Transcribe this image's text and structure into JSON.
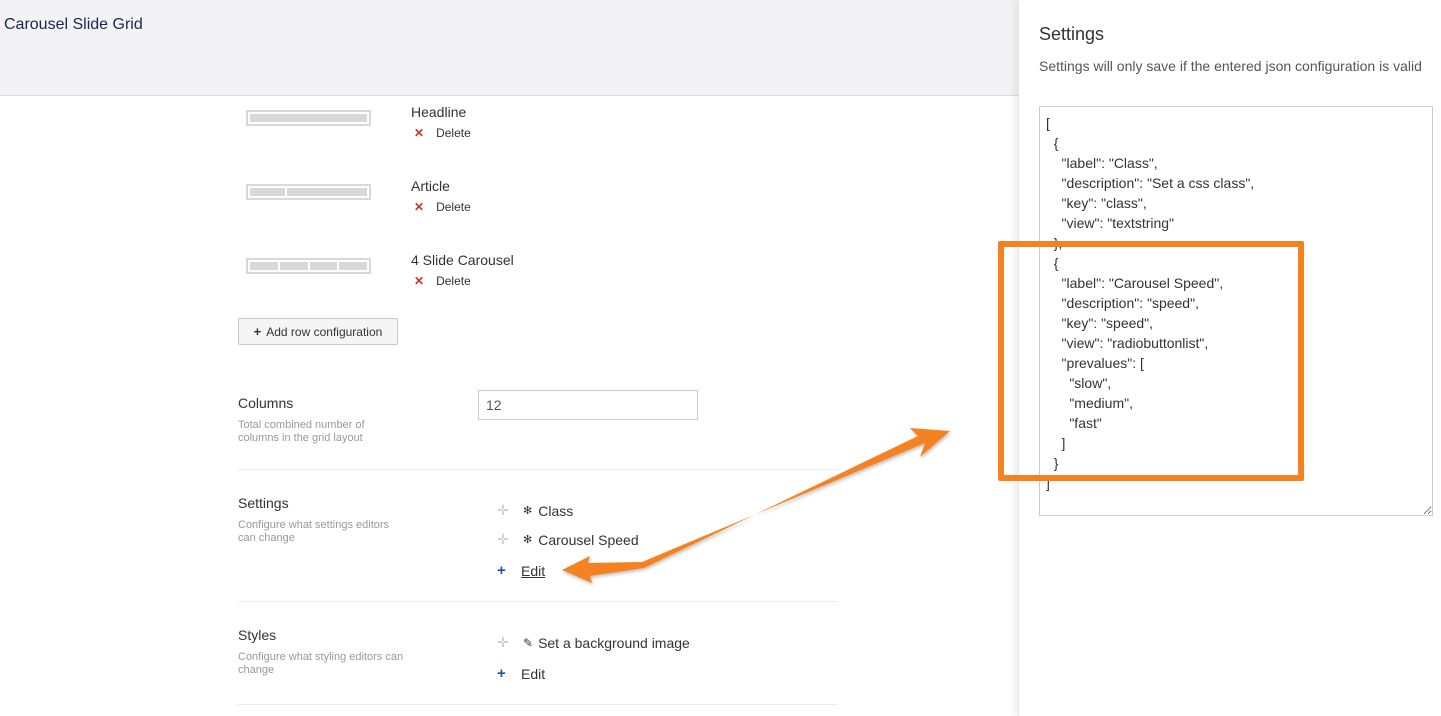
{
  "header": {
    "title": "Carousel Slide Grid"
  },
  "layouts": [
    {
      "name": "Headline",
      "cells": 1,
      "delete_label": "Delete"
    },
    {
      "name": "Article",
      "cells": 2,
      "delete_label": "Delete"
    },
    {
      "name": "4 Slide Carousel",
      "cells": 4,
      "delete_label": "Delete"
    }
  ],
  "add_row_label": "Add row configuration",
  "columns": {
    "label": "Columns",
    "description": "Total combined number of columns in the grid layout",
    "value": "12"
  },
  "settings": {
    "label": "Settings",
    "description": "Configure what settings editors can change",
    "items": [
      "Class",
      "Carousel Speed"
    ],
    "edit_label": "Edit"
  },
  "styles": {
    "label": "Styles",
    "description": "Configure what styling editors can change",
    "items": [
      "Set a background image"
    ],
    "edit_label": "Edit"
  },
  "panel": {
    "title": "Settings",
    "description": "Settings will only save if the entered json configuration is valid",
    "json": "[\n  {\n    \"label\": \"Class\",\n    \"description\": \"Set a css class\",\n    \"key\": \"class\",\n    \"view\": \"textstring\"\n  },\n  {\n    \"label\": \"Carousel Speed\",\n    \"description\": \"speed\",\n    \"key\": \"speed\",\n    \"view\": \"radiobuttonlist\",\n    \"prevalues\": [\n      \"slow\",\n      \"medium\",\n      \"fast\"\n    ]\n  }\n]"
  },
  "colors": {
    "annotation": "#f58220",
    "delete_x": "#c0392b",
    "edit_plus": "#2152a3",
    "header_bg": "#f3f3f5"
  },
  "icons": {
    "drag": "drag-handle-icon",
    "gear": "gear-icon",
    "brush": "brush-icon",
    "plus": "plus-icon",
    "delete": "delete-x-icon"
  }
}
